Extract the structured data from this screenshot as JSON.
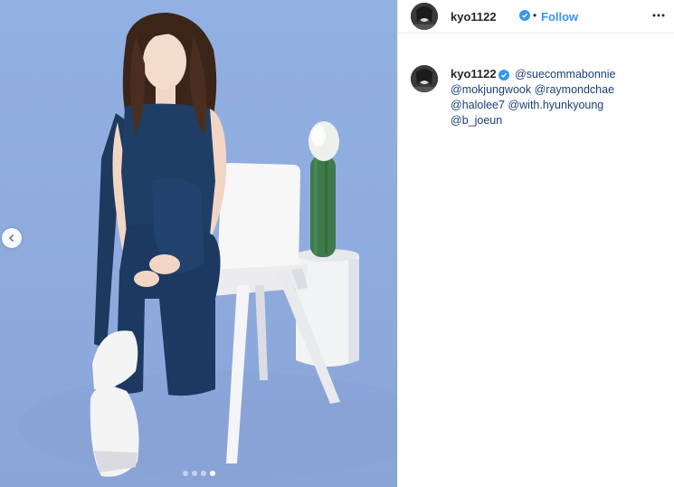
{
  "post": {
    "username": "kyo1122",
    "verified": true,
    "follow_label": "Follow",
    "separator": "•",
    "carousel": {
      "total": 4,
      "active_index": 3
    },
    "caption": {
      "mentions": [
        "@suecommabonnie",
        "@mokjungwook",
        "@raymondchae",
        "@halolee7",
        "@with.hyunkyoung",
        "@b_joeun"
      ]
    }
  },
  "colors": {
    "background_blue": "#8fabde",
    "link_blue": "#3897f0",
    "mention_color": "#1a3f7a",
    "text": "#262626"
  },
  "icons": {
    "prev": "chevron-left-icon",
    "verified": "verified-badge-icon",
    "more": "more-options-icon"
  }
}
